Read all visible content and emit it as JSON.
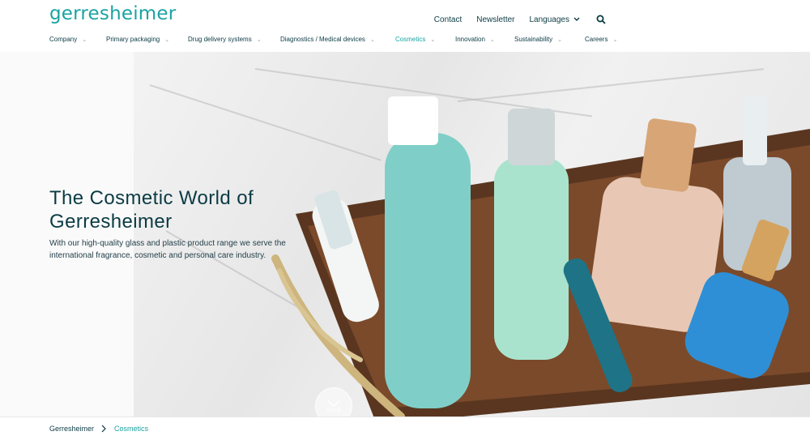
{
  "brand": {
    "logo": "gerresheimer"
  },
  "utility_nav": {
    "contact": "Contact",
    "newsletter": "Newsletter",
    "languages": "Languages",
    "search_icon": "search-icon"
  },
  "main_nav": [
    {
      "label": "Company"
    },
    {
      "label": "Primary packaging"
    },
    {
      "label": "Drug delivery systems"
    },
    {
      "label": "Diagnostics / Medical devices"
    },
    {
      "label": "Cosmetics",
      "active": true
    },
    {
      "label": "Innovation"
    },
    {
      "label": "Sustainability"
    },
    {
      "label": "Careers"
    }
  ],
  "hero": {
    "title_line1": "The Cosmetic World of",
    "title_line2": "Gerresheimer",
    "text": "With our high-quality glass and plastic product range we serve the international fragrance, cosmetic and personal care industry.",
    "scroll_label": "Scroll"
  },
  "breadcrumb": {
    "home": "Gerresheimer",
    "current": "Cosmetics"
  },
  "colors": {
    "accent": "#1aa3a3",
    "text_dark": "#0b3b44"
  }
}
